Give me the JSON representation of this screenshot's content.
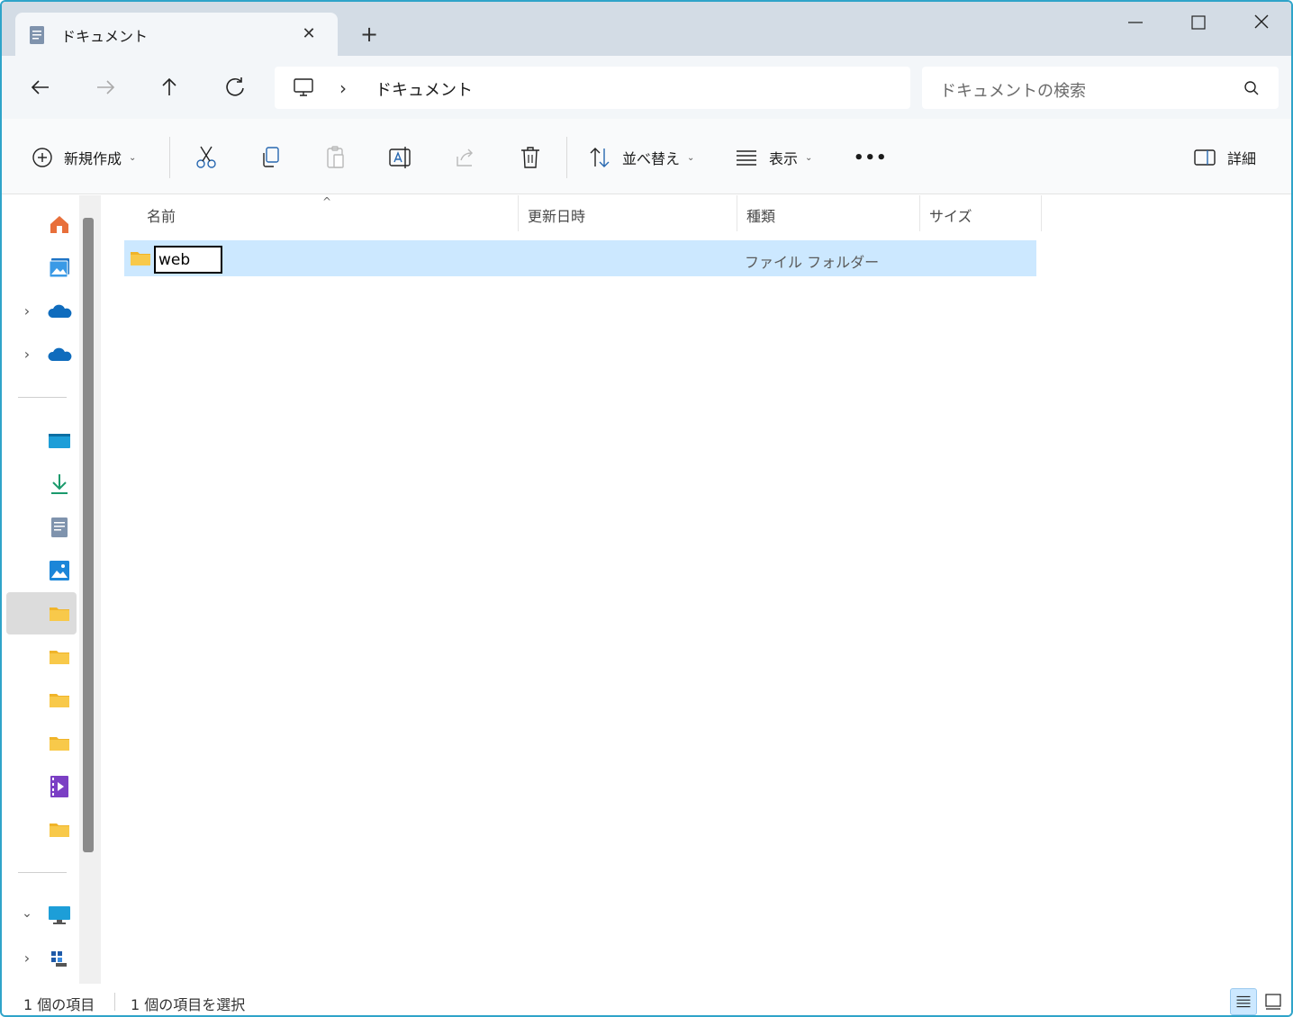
{
  "window": {
    "tab_title": "ドキュメント",
    "tab_close": "✕",
    "new_tab": "+"
  },
  "navigation": {
    "breadcrumb_separator": "›",
    "breadcrumb_current": "ドキュメント",
    "search_placeholder": "ドキュメントの検索"
  },
  "toolbar": {
    "new_label": "新規作成",
    "sort_label": "並べ替え",
    "view_label": "表示",
    "more_label": "•••",
    "details_label": "詳細"
  },
  "columns": {
    "name": "名前",
    "modified": "更新日時",
    "type": "種類",
    "size": "サイズ"
  },
  "files": [
    {
      "name": "web",
      "type": "ファイル フォルダー",
      "selected": true,
      "renaming": true
    }
  ],
  "sidebar": {
    "items": [
      {
        "icon": "home-icon",
        "expandable": false
      },
      {
        "icon": "gallery-icon",
        "expandable": false
      },
      {
        "icon": "onedrive-icon",
        "expandable": true
      },
      {
        "icon": "onedrive-icon",
        "expandable": true
      },
      {
        "icon": "desktop-icon",
        "expandable": false
      },
      {
        "icon": "downloads-icon",
        "expandable": false
      },
      {
        "icon": "documents-icon",
        "expandable": false
      },
      {
        "icon": "pictures-icon",
        "expandable": false
      },
      {
        "icon": "folder-icon",
        "selected": true
      },
      {
        "icon": "folder-icon"
      },
      {
        "icon": "folder-icon"
      },
      {
        "icon": "folder-icon"
      },
      {
        "icon": "videos-icon"
      },
      {
        "icon": "folder-icon"
      },
      {
        "icon": "this-pc-icon",
        "expanded": true
      },
      {
        "icon": "network-drive-icon",
        "expandable": true
      }
    ]
  },
  "status": {
    "item_count": "1 個の項目",
    "selected_count": "1 個の項目を選択"
  },
  "colors": {
    "accent": "#2fa4c9",
    "selection": "#cce8ff",
    "folder": "#f8c94a"
  }
}
